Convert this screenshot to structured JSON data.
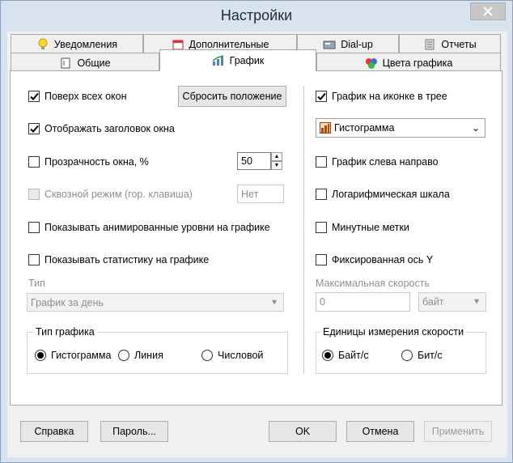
{
  "window": {
    "title": "Настройки"
  },
  "tabs_row1": [
    {
      "label": "Уведомления",
      "icon": "lightbulb-icon"
    },
    {
      "label": "Дополнительные",
      "icon": "calendar-icon"
    },
    {
      "label": "Dial-up",
      "icon": "modem-icon"
    },
    {
      "label": "Отчеты",
      "icon": "report-icon"
    }
  ],
  "tabs_row2": [
    {
      "label": "Общие",
      "icon": "general-icon"
    },
    {
      "label": "График",
      "icon": "chart-icon",
      "active": true
    },
    {
      "label": "Цвета графика",
      "icon": "palette-icon"
    }
  ],
  "left": {
    "always_on_top": {
      "label": "Поверх всех окон",
      "checked": true
    },
    "reset_position": "Сбросить положение",
    "show_caption": {
      "label": "Отображать заголовок окна",
      "checked": true
    },
    "transparency": {
      "label": "Прозрачность окна, %",
      "checked": false,
      "value": "50"
    },
    "click_through": {
      "label": "Сквозной режим (гор. клавиша)",
      "checked": false,
      "hotkey": "Нет"
    },
    "animated_levels": {
      "label": "Показывать анимированные уровни на графике",
      "checked": false
    },
    "show_stats": {
      "label": "Показывать статистику на графике",
      "checked": false
    },
    "type_label": "Тип",
    "type_value": "График за день",
    "chart_type": {
      "title": "Тип графика",
      "options": [
        "Гистограмма",
        "Линия",
        "Числовой"
      ],
      "selected": "Гистограмма"
    }
  },
  "right": {
    "tray_chart": {
      "label": "График на иконке в трее",
      "checked": true
    },
    "tray_type_value": "Гистограмма",
    "left_to_right": {
      "label": "График слева направо",
      "checked": false
    },
    "log_scale": {
      "label": "Логарифмическая шкала",
      "checked": false
    },
    "minute_marks": {
      "label": "Минутные метки",
      "checked": false
    },
    "fixed_y": {
      "label": "Фиксированная ось Y",
      "checked": false
    },
    "max_speed_label": "Максимальная скорость",
    "max_speed_value": "0",
    "max_speed_unit": "байт",
    "units": {
      "title": "Единицы измерения скорости",
      "options": [
        "Байт/с",
        "Бит/с"
      ],
      "selected": "Байт/с"
    }
  },
  "footer": {
    "help": "Справка",
    "password": "Пароль...",
    "ok": "OK",
    "cancel": "Отмена",
    "apply": "Применить"
  },
  "colors": {
    "accent": "#1e2b3a",
    "close_bg": "#c7c7c7",
    "frame": "#d9e3ef"
  }
}
